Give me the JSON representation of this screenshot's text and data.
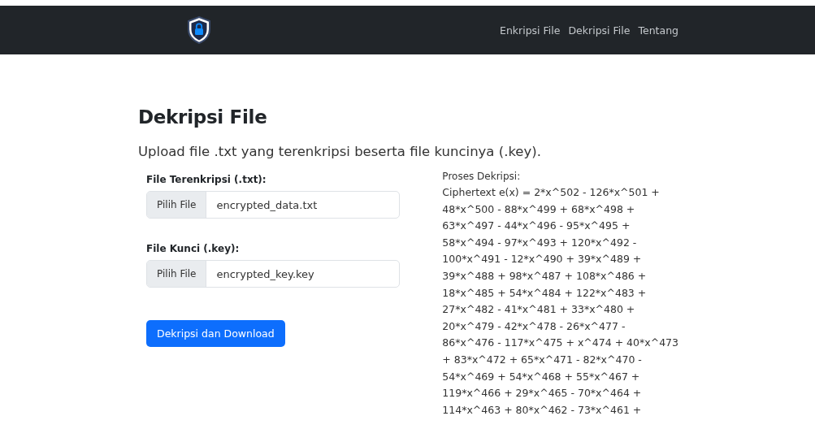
{
  "navbar": {
    "links": [
      {
        "label": "Enkripsi File"
      },
      {
        "label": "Dekripsi File"
      },
      {
        "label": "Tentang"
      }
    ]
  },
  "heading": "Dekripsi File",
  "subtitle": "Upload file .txt yang terenkripsi beserta file kuncinya (.key).",
  "fields": [
    {
      "label": "File Terenkripsi (.txt):",
      "button": "Pilih File",
      "value": "encrypted_data.txt"
    },
    {
      "label": "File Kunci (.key):",
      "button": "Pilih File",
      "value": "encrypted_key.key"
    }
  ],
  "submit": "Dekripsi dan Download",
  "process": {
    "title": "Proses Dekripsi:",
    "lines": [
      "Ciphertext e(x) = 2*x^502 - 126*x^501 +",
      "48*x^500 - 88*x^499 + 68*x^498 +",
      "63*x^497 - 44*x^496 - 95*x^495 +",
      "58*x^494 - 97*x^493 + 120*x^492 -",
      "100*x^491 - 12*x^490 + 39*x^489 +",
      "39*x^488 + 98*x^487 + 108*x^486 +",
      "18*x^485 + 54*x^484 + 122*x^483 +",
      "27*x^482 - 41*x^481 + 33*x^480 +",
      "20*x^479 - 42*x^478 - 26*x^477 -",
      "86*x^476 - 117*x^475 + x^474 + 40*x^473",
      "+ 83*x^472 + 65*x^471 - 82*x^470 -",
      "54*x^469 + 54*x^468 + 55*x^467 +",
      "119*x^466 + 29*x^465 - 70*x^464 +",
      "114*x^463 + 80*x^462 - 73*x^461 +"
    ]
  }
}
